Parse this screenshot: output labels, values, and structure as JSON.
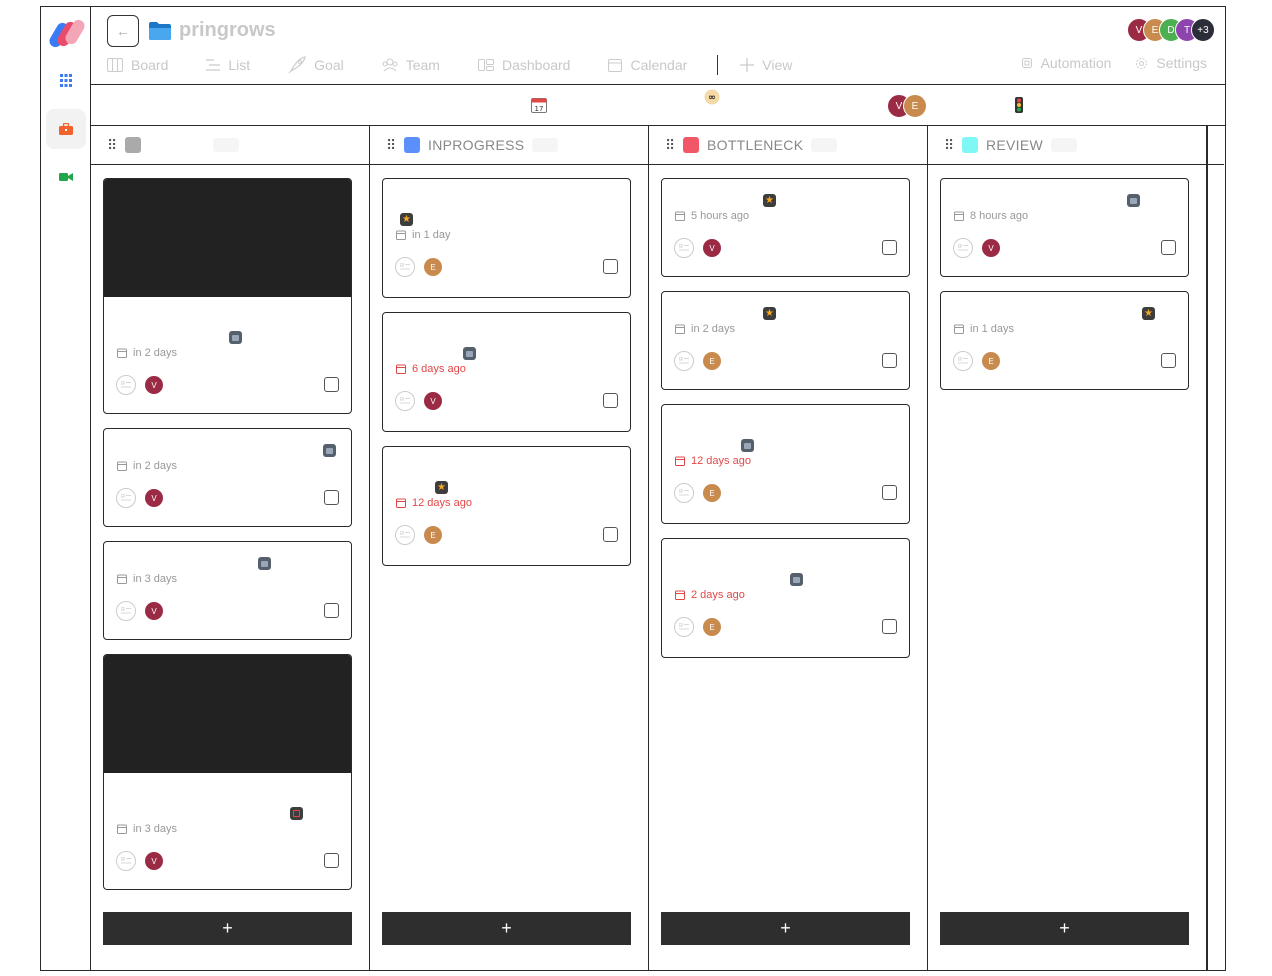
{
  "project": {
    "title": "pringrows"
  },
  "views": [
    {
      "label": "Board",
      "icon": "board-icon"
    },
    {
      "label": "List",
      "icon": "list-icon"
    },
    {
      "label": "Goal",
      "icon": "rocket-icon"
    },
    {
      "label": "Team",
      "icon": "team-icon"
    },
    {
      "label": "Dashboard",
      "icon": "dashboard-icon"
    },
    {
      "label": "Calendar",
      "icon": "calendar-icon"
    },
    {
      "label": "View",
      "icon": "plus-icon"
    }
  ],
  "header_right": [
    {
      "label": "Automation",
      "icon": "automation-icon"
    },
    {
      "label": "Settings",
      "icon": "gear-icon"
    }
  ],
  "members": [
    {
      "initial": "V",
      "color": "#9b2a45"
    },
    {
      "initial": "E",
      "color": "#c98a4e"
    },
    {
      "initial": "D",
      "color": "#4caf50"
    },
    {
      "initial": "T",
      "color": "#8e44ad"
    },
    {
      "initial": "+3",
      "color": "#2b2d38"
    }
  ],
  "toolbar_avatars": [
    {
      "initial": "V",
      "color": "#9b2a45"
    },
    {
      "initial": "E",
      "color": "#c98a4e"
    }
  ],
  "columns": [
    {
      "name": "",
      "color": "#aaaaaa",
      "add_label": "+",
      "cards": [
        {
          "cover": true,
          "priority": "gray",
          "due": "in 2 days",
          "overdue": false,
          "assignee": "V"
        },
        {
          "cover": false,
          "priority": "gray",
          "due": "in 2 days",
          "overdue": false,
          "assignee": "V"
        },
        {
          "cover": false,
          "priority": "gray",
          "due": "in 3 days",
          "overdue": false,
          "assignee": "V"
        },
        {
          "cover": true,
          "priority": "red",
          "due": "in 3 days",
          "overdue": false,
          "assignee": "V"
        }
      ]
    },
    {
      "name": "INPROGRESS",
      "color": "#5b8ff9",
      "add_label": "+",
      "cards": [
        {
          "cover": false,
          "priority": "star",
          "due": "in 1 day",
          "overdue": false,
          "assignee": "E"
        },
        {
          "cover": false,
          "priority": "gray",
          "due": "6 days ago",
          "overdue": true,
          "assignee": "V"
        },
        {
          "cover": false,
          "priority": "star",
          "due": "12 days ago",
          "overdue": true,
          "assignee": "E"
        }
      ]
    },
    {
      "name": "BOTTLENECK",
      "color": "#f25767",
      "add_label": "+",
      "cards": [
        {
          "cover": false,
          "priority": "star",
          "due": "5 hours ago",
          "overdue": false,
          "assignee": "V"
        },
        {
          "cover": false,
          "priority": "star",
          "due": "in 2 days",
          "overdue": false,
          "assignee": "E"
        },
        {
          "cover": false,
          "priority": "gray",
          "due": "12 days ago",
          "overdue": true,
          "assignee": "E"
        },
        {
          "cover": false,
          "priority": "gray",
          "due": "2 days ago",
          "overdue": true,
          "assignee": "E"
        }
      ]
    },
    {
      "name": "REVIEW",
      "color": "#7ff7f7",
      "add_label": "+",
      "cards": [
        {
          "cover": false,
          "priority": "gray",
          "due": "8 hours ago",
          "overdue": false,
          "assignee": "V"
        },
        {
          "cover": false,
          "priority": "star",
          "due": "in 1 days",
          "overdue": false,
          "assignee": "E"
        }
      ]
    }
  ]
}
